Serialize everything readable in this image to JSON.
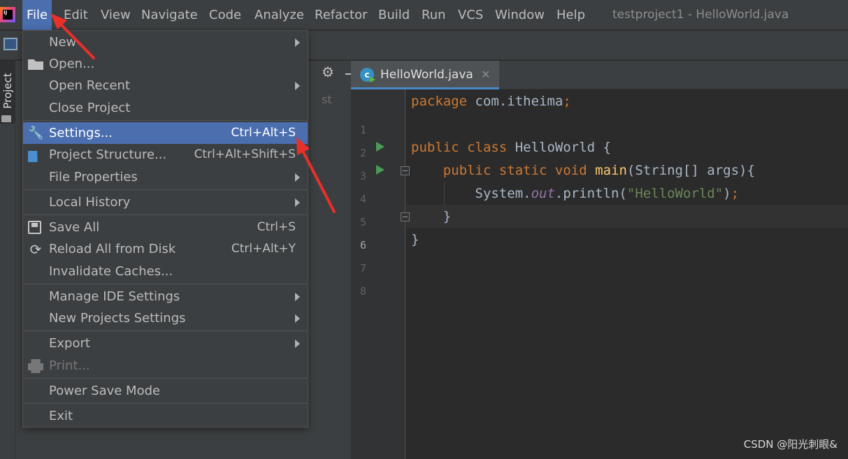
{
  "menubar": {
    "items": [
      "File",
      "Edit",
      "View",
      "Navigate",
      "Code",
      "Analyze",
      "Refactor",
      "Build",
      "Run",
      "VCS",
      "Window",
      "Help"
    ],
    "window_title": "testproject1 - HelloWorld.java"
  },
  "sidebar": {
    "project_tab": "Project"
  },
  "project_panel": {
    "ghost_text": "st"
  },
  "editor": {
    "tab_label": "HelloWorld.java",
    "tab_icon": "java-class-icon",
    "current_line": 6,
    "line_numbers": [
      "1",
      "2",
      "3",
      "4",
      "5",
      "6",
      "7",
      "8"
    ],
    "code": {
      "l1_kw": "package",
      "l1_rest": " com.itheima",
      "l1_semi": ";",
      "l3_kw": "public class",
      "l3_rest": " HelloWorld {",
      "l4_kw": "public static void",
      "l4_fn": "main",
      "l4_rest": "(String[] args){",
      "l5_pre": "System.",
      "l5_field": "out",
      "l5_mid": ".println(",
      "l5_str": "\"HelloWorld\"",
      "l5_end": ")",
      "l5_semi": ";",
      "l6": "}",
      "l7": "}"
    }
  },
  "file_menu": {
    "items": [
      {
        "label": "New",
        "submenu": true
      },
      {
        "label": "Open...",
        "icon": "folder-open-icon"
      },
      {
        "label": "Open Recent",
        "submenu": true
      },
      {
        "label": "Close Project"
      },
      {
        "label": "Settings...",
        "shortcut": "Ctrl+Alt+S",
        "icon": "wrench-icon",
        "selected": true
      },
      {
        "label": "Project Structure...",
        "shortcut": "Ctrl+Alt+Shift+S",
        "icon": "project-structure-icon"
      },
      {
        "label": "File Properties",
        "submenu": true
      },
      {
        "label": "Local History",
        "submenu": true
      },
      {
        "label": "Save All",
        "shortcut": "Ctrl+S",
        "icon": "save-icon"
      },
      {
        "label": "Reload All from Disk",
        "shortcut": "Ctrl+Alt+Y",
        "icon": "reload-icon"
      },
      {
        "label": "Invalidate Caches..."
      },
      {
        "label": "Manage IDE Settings",
        "submenu": true
      },
      {
        "label": "New Projects Settings",
        "submenu": true
      },
      {
        "label": "Export",
        "submenu": true
      },
      {
        "label": "Print...",
        "icon": "print-icon",
        "disabled": true
      },
      {
        "label": "Power Save Mode"
      },
      {
        "label": "Exit"
      }
    ]
  },
  "watermark": "CSDN @阳光刺眼&",
  "colors": {
    "accent": "#4b6eaf",
    "keyword": "#cc7832",
    "function": "#ffc66d",
    "string": "#6a8759",
    "field": "#9876aa",
    "annotation_arrow": "#e8302a"
  }
}
